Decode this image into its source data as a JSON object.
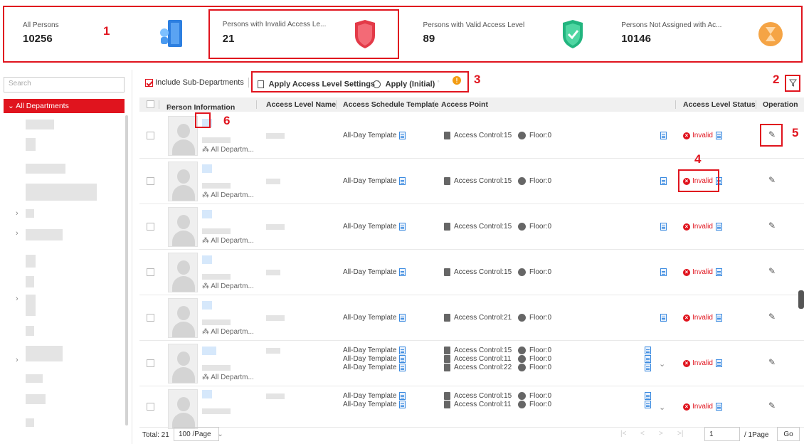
{
  "stats": [
    {
      "label": "All Persons",
      "value": "10256",
      "icon": "door-icon",
      "color": "#2d7fe0"
    },
    {
      "label": "Persons with Invalid Access Le...",
      "value": "21",
      "icon": "red-shield-icon",
      "color": "#e33a48"
    },
    {
      "label": "Persons with Valid Access Level",
      "value": "89",
      "icon": "green-shield-icon",
      "color": "#28c28a"
    },
    {
      "label": "Persons Not Assigned with Ac...",
      "value": "10146",
      "icon": "orange-hourglass-icon",
      "color": "#f5a445"
    }
  ],
  "annotations": [
    "1",
    "2",
    "3",
    "4",
    "5",
    "6"
  ],
  "sidebar": {
    "search_placeholder": "Search",
    "root": "All Departments"
  },
  "toolbar": {
    "include_sub": "Include Sub-Departments",
    "apply_settings": "Apply Access Level Settings",
    "apply_initial": "Apply (Initial)"
  },
  "table": {
    "headers": [
      "Person Information",
      "Access Level Name",
      "Access Schedule Template",
      "Access Point",
      "Access Level Status",
      "Operation"
    ],
    "rows": [
      {
        "dept": "All Departm...",
        "template": [
          "All-Day Template"
        ],
        "points": [
          "Access Control:15"
        ],
        "floors": [
          "Floor:0"
        ],
        "status": "Invalid"
      },
      {
        "dept": "All Departm...",
        "template": [
          "All-Day Template"
        ],
        "points": [
          "Access Control:15"
        ],
        "floors": [
          "Floor:0"
        ],
        "status": "Invalid"
      },
      {
        "dept": "All Departm...",
        "template": [
          "All-Day Template"
        ],
        "points": [
          "Access Control:15"
        ],
        "floors": [
          "Floor:0"
        ],
        "status": "Invalid"
      },
      {
        "dept": "All Departm...",
        "template": [
          "All-Day Template"
        ],
        "points": [
          "Access Control:15"
        ],
        "floors": [
          "Floor:0"
        ],
        "status": "Invalid"
      },
      {
        "dept": "All Departm...",
        "template": [
          "All-Day Template"
        ],
        "points": [
          "Access Control:21"
        ],
        "floors": [
          "Floor:0"
        ],
        "status": "Invalid"
      },
      {
        "dept": "All Departm...",
        "template": [
          "All-Day Template",
          "All-Day Template",
          "All-Day Template"
        ],
        "points": [
          "Access Control:15",
          "Access Control:11",
          "Access Control:22"
        ],
        "floors": [
          "Floor:0",
          "Floor:0",
          "Floor:0"
        ],
        "status": "Invalid"
      },
      {
        "dept": "",
        "template": [
          "All-Day Template",
          "All-Day Template"
        ],
        "points": [
          "Access Control:15",
          "Access Control:11"
        ],
        "floors": [
          "Floor:0",
          "Floor:0"
        ],
        "status": "Invalid"
      }
    ]
  },
  "footer": {
    "total": "Total: 21",
    "page_size": "100 /Page",
    "page": "1",
    "page_total": "/ 1Page",
    "go": "Go"
  }
}
